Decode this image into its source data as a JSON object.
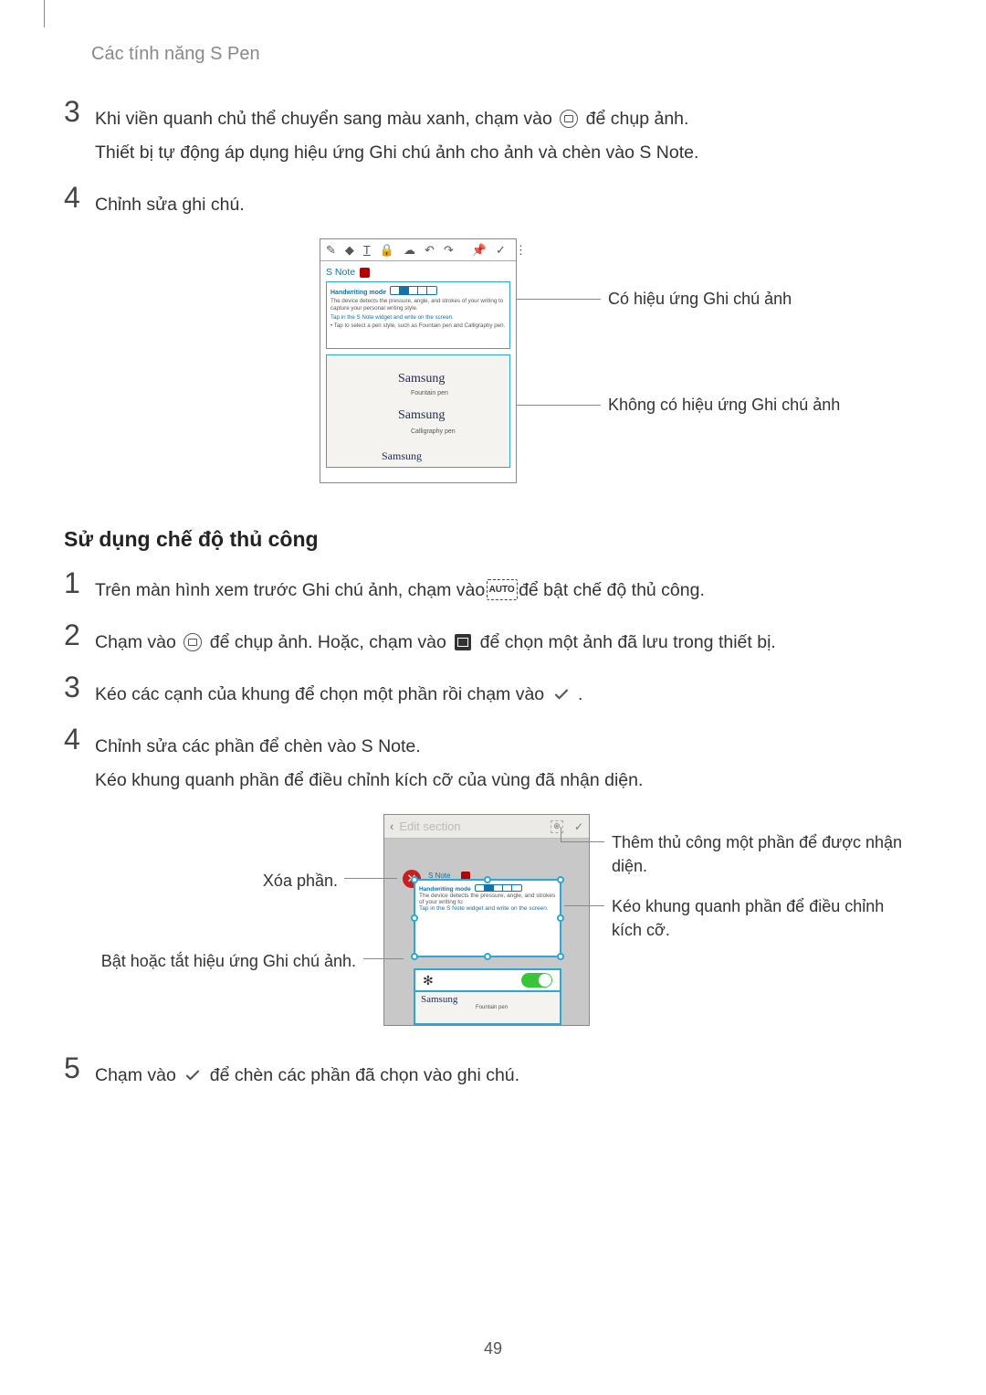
{
  "header": "Các tính năng S Pen",
  "steps_a": {
    "s3": {
      "n": "3",
      "line1_pre": "Khi viền quanh chủ thể chuyển sang màu xanh, chạm vào ",
      "line1_post": " để chụp ảnh.",
      "line2": "Thiết bị tự động áp dụng hiệu ứng Ghi chú ảnh cho ảnh và chèn vào S Note."
    },
    "s4": {
      "n": "4",
      "text": "Chỉnh sửa ghi chú."
    }
  },
  "fig1": {
    "snote": "S Note",
    "handwriting": "Handwriting mode",
    "desc1": "The device detects the pressure, angle, and strokes of your writing to capture your personal writing style.",
    "desc2a": "Tap      in the S Note widget and write on the screen.",
    "desc2b": "• Tap      to select a pen style, such as Fountain pen and Calligraphy pen.",
    "fountain": "Samsung",
    "fountain_lbl": "Fountain pen",
    "calli": "Samsung",
    "calli_lbl": "Calligraphy pen",
    "bottom": "Samsung",
    "callout_top": "Có hiệu ứng Ghi chú ảnh",
    "callout_bot": "Không có hiệu ứng Ghi chú ảnh"
  },
  "subhead": "Sử dụng chế độ thủ công",
  "steps_b": {
    "s1": {
      "n": "1",
      "pre": "Trên màn hình xem trước Ghi chú ảnh, chạm vào ",
      "post": " để bật chế độ thủ công."
    },
    "s2": {
      "n": "2",
      "pre": "Chạm vào ",
      "mid": " để chụp ảnh. Hoặc, chạm vào ",
      "post": " để chọn một ảnh đã lưu trong thiết bị."
    },
    "s3": {
      "n": "3",
      "pre": "Kéo các cạnh của khung để chọn một phần rồi chạm vào ",
      "post": "."
    },
    "s4": {
      "n": "4",
      "line1": "Chỉnh sửa các phần để chèn vào S Note.",
      "line2": "Kéo khung quanh phần để điều chỉnh kích cỡ của vùng đã nhận diện."
    },
    "s5": {
      "n": "5",
      "pre": "Chạm vào ",
      "post": " để chèn các phần đã chọn vào ghi chú."
    }
  },
  "fig2": {
    "edit_section": "Edit section",
    "snote": "S Note",
    "handwriting": "Handwriting mode",
    "desc1": "The device detects the pressure, angle, and strokes of your writing to",
    "desc2": "Tap      in the S Note widget and write on the screen.",
    "fountain_lbl": "Fountain pen",
    "script": "Samsung",
    "callouts": {
      "left_top": "Xóa phần.",
      "left_bot": "Bật hoặc tắt hiệu ứng Ghi chú ảnh.",
      "right_top": "Thêm thủ công một phần để được nhận diện.",
      "right_bot": "Kéo khung quanh phần để điều chỉnh kích cỡ."
    }
  },
  "pagenum": "49"
}
